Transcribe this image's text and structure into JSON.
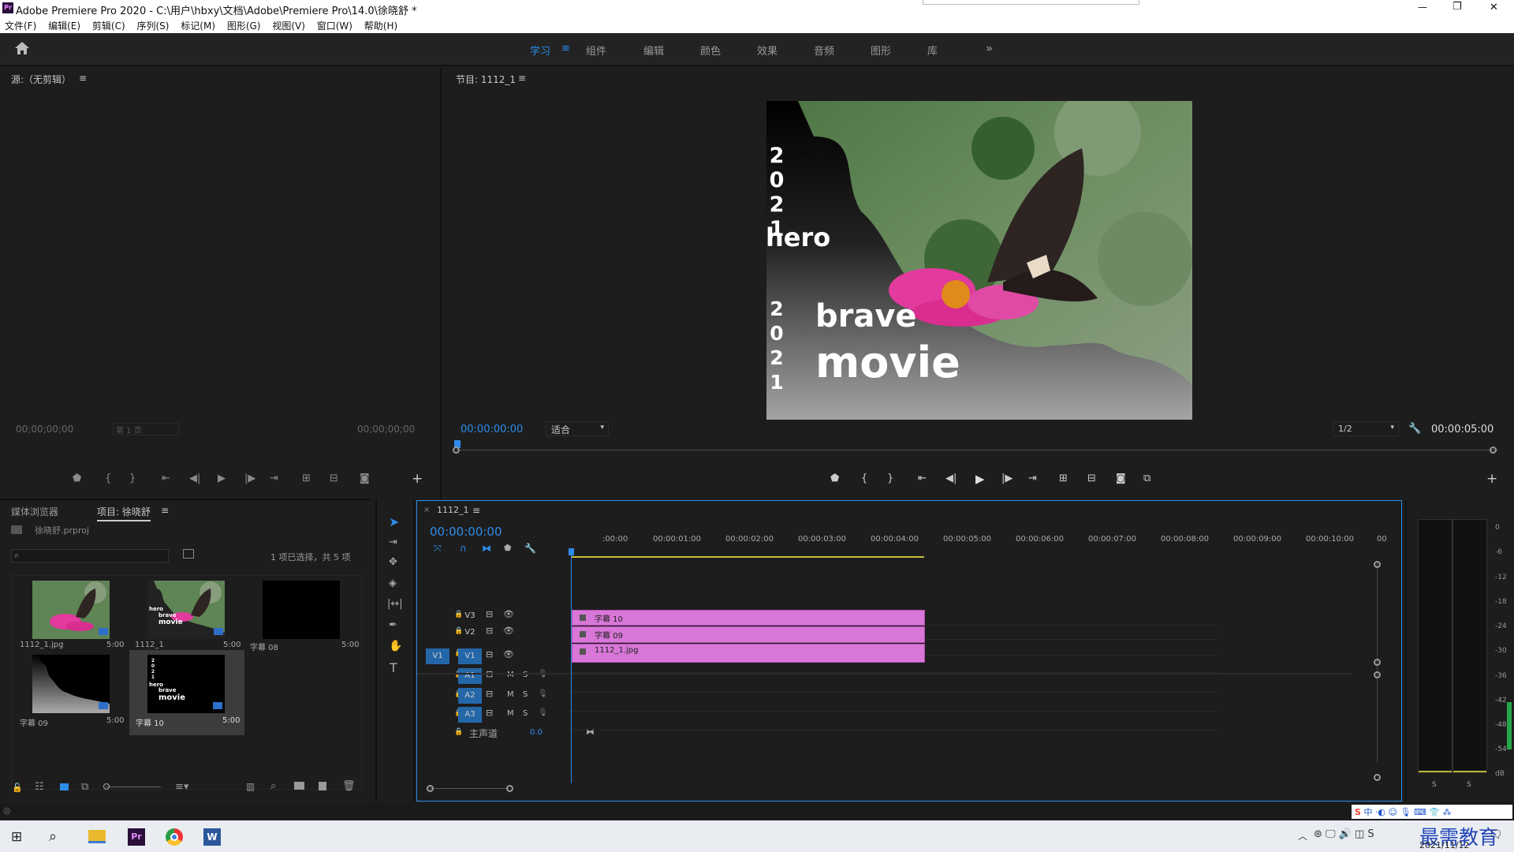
{
  "window": {
    "title": "Adobe Premiere Pro 2020 - C:\\用户\\hbxy\\文档\\Adobe\\Premiere Pro\\14.0\\徐晓舒 *",
    "controls": [
      "—",
      "❐",
      "✕"
    ]
  },
  "menu": [
    "文件(F)",
    "编辑(E)",
    "剪辑(C)",
    "序列(S)",
    "标记(M)",
    "图形(G)",
    "视图(V)",
    "窗口(W)",
    "帮助(H)"
  ],
  "workspaces": {
    "active": "学习",
    "items": [
      "组件",
      "编辑",
      "颜色",
      "效果",
      "音频",
      "图形",
      "库"
    ],
    "more": "»"
  },
  "source": {
    "title": "源:（无剪辑）",
    "timecode_left": "00;00;00;00",
    "page": "第 1 页",
    "timecode_right": "00;00;00;00"
  },
  "program": {
    "title": "节目: 1112_1",
    "timecode": "00:00:00:00",
    "fit": "适合",
    "resolution": "1/2",
    "duration": "00:00:05:00"
  },
  "video_frame": {
    "vertical_top": [
      "2",
      "0",
      "2",
      "1"
    ],
    "hero": "hero",
    "vertical_bottom": [
      "2",
      "0",
      "2",
      "1"
    ],
    "brave": "brave",
    "movie": "movie"
  },
  "project": {
    "tab_media": "媒体浏览器",
    "tab_project": "项目: 徐晓舒",
    "file": "徐晓舒.prproj",
    "selection": "1 项已选择，共 5 项",
    "items": [
      {
        "name": "1112_1.jpg",
        "dur": "5:00"
      },
      {
        "name": "1112_1",
        "dur": "5:00"
      },
      {
        "name": "字幕 08",
        "dur": "5:00"
      },
      {
        "name": "字幕 09",
        "dur": "5:00"
      },
      {
        "name": "字幕 10",
        "dur": "5:00"
      }
    ]
  },
  "timeline": {
    "tab": "1112_1",
    "timecode": "00:00:00:00",
    "ruler": [
      ":00:00",
      "00:00:01:00",
      "00:00:02:00",
      "00:00:03:00",
      "00:00:04:00",
      "00:00:05:00",
      "00:00:06:00",
      "00:00:07:00",
      "00:00:08:00",
      "00:00:09:00",
      "00:00:10:00",
      "00"
    ],
    "video_tracks": [
      {
        "name": "V3",
        "clip": "字幕 10"
      },
      {
        "name": "V2",
        "clip": "字幕 09"
      },
      {
        "name": "V1",
        "clip": "1112_1.jpg",
        "source": "V1"
      }
    ],
    "audio_tracks": [
      "A1",
      "A2",
      "A3"
    ],
    "track_flags": {
      "m": "M",
      "s": "S"
    },
    "master": {
      "label": "主声道",
      "value": "0.0"
    }
  },
  "meter": {
    "scale": [
      "0",
      "-6",
      "-12",
      "-18",
      "-24",
      "-30",
      "-36",
      "-42",
      "-48",
      "-54",
      "dB"
    ],
    "solo": [
      "S",
      "S"
    ]
  },
  "tray": {
    "ime": "中",
    "date": "2021/11/12",
    "watermark": "最需教育"
  },
  "colors": {
    "accent": "#2d8ceb",
    "clip": "#d877d8",
    "panel": "#1d1d1d"
  }
}
